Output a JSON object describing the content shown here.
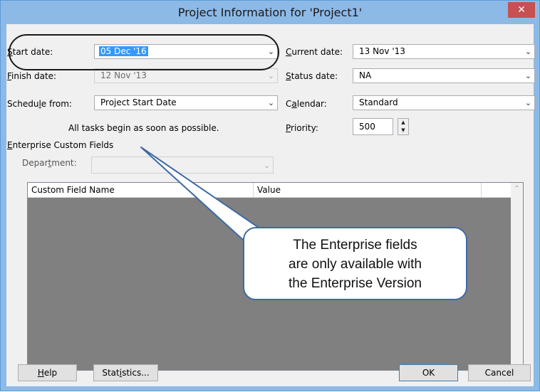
{
  "window": {
    "title": "Project Information for 'Project1'",
    "close_glyph": "✕"
  },
  "fields": {
    "start_date": {
      "label_pre": "",
      "label_key": "S",
      "label_post": "tart date:",
      "value": "05 Dec '16"
    },
    "finish_date": {
      "label_pre": "",
      "label_key": "F",
      "label_post": "inish date:",
      "value": "12 Nov '13"
    },
    "schedule_from": {
      "label_pre": "Schedu",
      "label_key": "l",
      "label_post": "e from:",
      "value": "Project Start Date"
    },
    "schedule_note": "All tasks begin as soon as possible.",
    "current_date": {
      "label_pre": "",
      "label_key": "C",
      "label_post": "urrent date:",
      "value": "13 Nov '13"
    },
    "status_date": {
      "label_pre": "",
      "label_key": "S",
      "label_post": "tatus date:",
      "value": "NA"
    },
    "calendar": {
      "label_pre": "C",
      "label_key": "a",
      "label_post": "lendar:",
      "value": "Standard"
    },
    "priority": {
      "label_pre": "",
      "label_key": "P",
      "label_post": "riority:",
      "value": "500"
    }
  },
  "enterprise": {
    "heading_pre": "",
    "heading_key": "E",
    "heading_post": "nterprise Custom Fields",
    "department": {
      "label_pre": "Depar",
      "label_key": "t",
      "label_post": "ment:",
      "value": ""
    },
    "columns": [
      "Custom Field Name",
      "Value"
    ]
  },
  "callout": {
    "lines": [
      "The Enterprise fields",
      "are only available with",
      "the Enterprise Version"
    ]
  },
  "buttons": {
    "help": {
      "pre": "",
      "key": "H",
      "post": "elp"
    },
    "statistics": {
      "pre": "Stat",
      "key": "i",
      "post": "stics..."
    },
    "ok": "OK",
    "cancel": "Cancel"
  },
  "icons": {
    "dropdown": "chevron-down-icon",
    "spin_up": "spin-up-icon",
    "spin_down": "spin-down-icon",
    "scroll_up": "scroll-up-icon",
    "scroll_down": "scroll-down-icon"
  },
  "colors": {
    "titlebar": "#8db9e6",
    "close_button": "#c75050",
    "selection": "#3399ff",
    "grid_background": "#808080",
    "callout_border": "#3e6aa3"
  }
}
